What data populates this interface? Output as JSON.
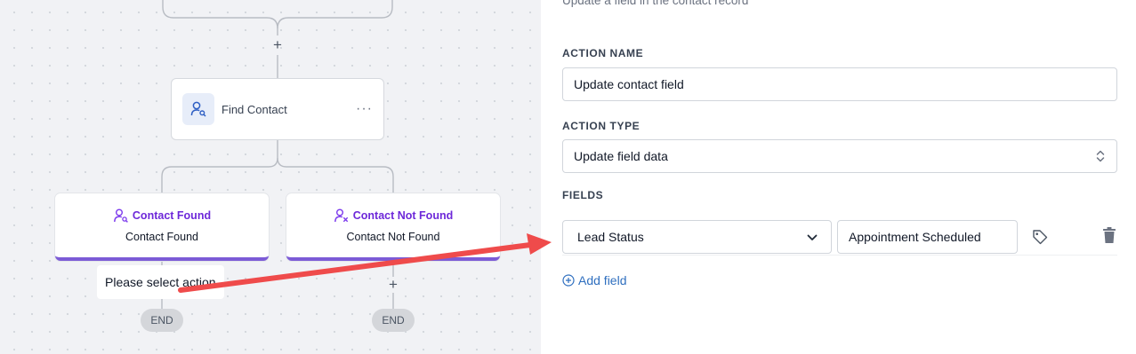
{
  "canvas": {
    "find_node": {
      "title": "Find Contact",
      "menu": "···"
    },
    "branches": [
      {
        "header": "Contact Found",
        "subtitle": "Contact Found"
      },
      {
        "header": "Contact Not Found",
        "subtitle": "Contact Not Found"
      }
    ],
    "add_glyph": "+",
    "tooltip": "Please select action",
    "end_label": "END"
  },
  "panel": {
    "description": "Update a field in the contact record",
    "action_name": {
      "label": "ACTION NAME",
      "value": "Update contact field"
    },
    "action_type": {
      "label": "ACTION TYPE",
      "value": "Update field data"
    },
    "fields": {
      "label": "FIELDS",
      "rows": [
        {
          "field": "Lead Status",
          "value": "Appointment Scheduled"
        }
      ],
      "add_label": "Add field"
    }
  },
  "colors": {
    "accent_purple": "#7c5bd6",
    "branch_text": "#6d28d9",
    "link_blue": "#2f6fbf",
    "annotation_red": "#ef4b4b"
  },
  "icons": [
    "user-search-icon",
    "user-check-icon",
    "user-x-icon",
    "chevron-down-icon",
    "select-arrows-icon",
    "tag-icon",
    "trash-icon",
    "plus-circle-icon"
  ]
}
